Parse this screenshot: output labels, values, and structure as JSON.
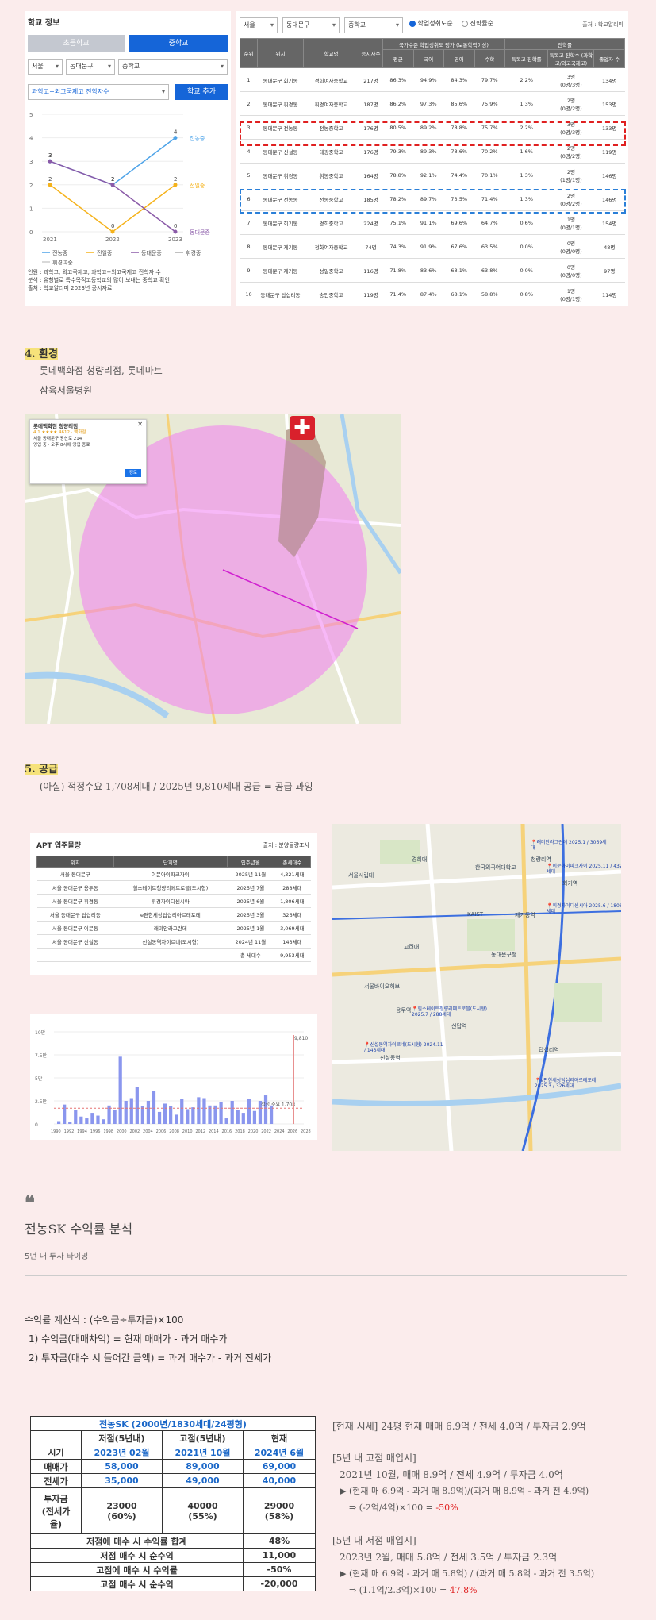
{
  "school": {
    "title": "학교 정보",
    "tab_elementary": "초등학교",
    "tab_middle": "중학교",
    "filter_city": "서울",
    "filter_district": "동대문구",
    "filter_level": "중학교",
    "filter_metric": "과학고+외고국제고 진학자수",
    "add_button": "학교 추가",
    "right_filter_city": "서울",
    "right_filter_district": "동대문구",
    "right_filter_level": "중학교",
    "radio_achievement": "학업성취도순",
    "radio_advance": "진학률순",
    "source": "출처 : 학교알리미",
    "chart_notes": [
      "인원 : 과학고, 외고국제고, 과학고+외고국제고 진학자 수",
      "분석 : 유형별로 특수목적고등학교의 많이 보내는 중학교 확인",
      "출처 : 학교알리미 2023년 공시자료"
    ],
    "table": {
      "headers_top": [
        "순위",
        "위치",
        "학교명",
        "응시자수",
        "국가수준 학업성취도 평가 (보통학력이상)",
        "진학률"
      ],
      "headers_sub": [
        "평균",
        "국어",
        "영어",
        "수학",
        "특목고 진학률",
        "특목고 진학수 (과학고/외고국제고)",
        "졸업자 수"
      ],
      "rows": [
        [
          "1",
          "동대문구 회기동",
          "경희여자중학교",
          "217명",
          "86.3%",
          "94.9%",
          "84.3%",
          "79.7%",
          "2.2%",
          "3명\n(0명/3명)",
          "134명"
        ],
        [
          "2",
          "동대문구 휘경동",
          "휘경여자중학교",
          "187명",
          "86.2%",
          "97.3%",
          "85.6%",
          "75.9%",
          "1.3%",
          "2명\n(0명/2명)",
          "153명"
        ],
        [
          "3",
          "동대문구 전농동",
          "전농중학교",
          "176명",
          "80.5%",
          "89.2%",
          "78.8%",
          "75.7%",
          "2.2%",
          "3명\n(0명/3명)",
          "133명"
        ],
        [
          "4",
          "동대문구 신설동",
          "대광중학교",
          "176명",
          "79.3%",
          "89.3%",
          "78.6%",
          "70.2%",
          "1.6%",
          "2명\n(0명/2명)",
          "119명"
        ],
        [
          "5",
          "동대문구 휘경동",
          "휘봉중학교",
          "164명",
          "78.8%",
          "92.1%",
          "74.4%",
          "70.1%",
          "1.3%",
          "2명\n(1명/1명)",
          "146명"
        ],
        [
          "6",
          "동대문구 전농동",
          "전동중학교",
          "185명",
          "78.2%",
          "89.7%",
          "73.5%",
          "71.4%",
          "1.3%",
          "2명\n(0명/2명)",
          "146명"
        ],
        [
          "7",
          "동대문구 회기동",
          "경희중학교",
          "224명",
          "75.1%",
          "91.1%",
          "69.6%",
          "64.7%",
          "0.6%",
          "1명\n(0명/1명)",
          "154명"
        ],
        [
          "8",
          "동대문구 제기동",
          "정화여자중학교",
          "74명",
          "74.3%",
          "91.9%",
          "67.6%",
          "63.5%",
          "0.0%",
          "0명\n(0명/0명)",
          "48명"
        ],
        [
          "9",
          "동대문구 제기동",
          "성일중학교",
          "116명",
          "71.8%",
          "83.6%",
          "68.1%",
          "63.8%",
          "0.0%",
          "0명\n(0명/0명)",
          "97명"
        ],
        [
          "10",
          "동대문구 답십리동",
          "숭인중학교",
          "119명",
          "71.4%",
          "87.4%",
          "68.1%",
          "58.8%",
          "0.8%",
          "1명\n(0명/1명)",
          "114명"
        ]
      ]
    }
  },
  "chart_data": [
    {
      "type": "line",
      "x": [
        "2021",
        "2022",
        "2023"
      ],
      "ylim": [
        0,
        5
      ],
      "yticks": [
        "0",
        "1",
        "2",
        "3",
        "4",
        "5"
      ],
      "series": [
        {
          "name": "전농중",
          "values": [
            3,
            2,
            4
          ],
          "color": "#4da3e8"
        },
        {
          "name": "전일중",
          "values": [
            2,
            0,
            2
          ],
          "color": "#f5b21a"
        },
        {
          "name": "동대문중",
          "values": [
            3,
            2,
            0
          ],
          "color": "#8a5aa8"
        }
      ],
      "legend": [
        "전농중",
        "전일중",
        "동대문중",
        "휘경중",
        "휘경여중"
      ],
      "end_labels": [
        "전농중",
        "전일중",
        "동대문중"
      ]
    },
    {
      "type": "bar",
      "ylim": [
        0,
        10
      ],
      "yticks": [
        "0",
        "2.5만",
        "5만",
        "7.5만",
        "10만"
      ],
      "xticks": [
        "1990",
        "1992",
        "1994",
        "1996",
        "1998",
        "2000",
        "2002",
        "2004",
        "2006",
        "2008",
        "2010",
        "2012",
        "2014",
        "2016",
        "2018",
        "2020",
        "2022",
        "2024",
        "2026",
        "2028"
      ],
      "values": [
        0.3,
        2.1,
        0.2,
        1.5,
        0.8,
        0.6,
        1.2,
        0.9,
        0.5,
        2.0,
        1.5,
        7.3,
        2.5,
        2.8,
        4.0,
        1.9,
        2.5,
        3.6,
        1.3,
        2.2,
        1.9,
        1.0,
        2.7,
        1.6,
        1.8,
        2.9,
        2.8,
        2.0,
        2.0,
        2.4,
        0.6,
        2.5,
        1.5,
        1.2,
        2.7,
        1.4,
        2.5,
        3.1,
        2.0
      ],
      "avg_label": "적정 수요 1,708",
      "marker_label": "9,810",
      "avg_value": 1.7
    }
  ],
  "env": {
    "heading": "4. 환경",
    "items": [
      "롯데백화점 청량리점, 롯데마트",
      "삼육서울병원"
    ]
  },
  "supply": {
    "heading": "5. 공급",
    "item": "(아실) 적정수요 1,708세대 / 2025년 9,810세대 공급 = 공급 과잉",
    "apt_title": "APT 입주물량",
    "apt_source": "출처 : 분양물량조사",
    "apt_headers": [
      "위치",
      "단지명",
      "입주년월",
      "총세대수"
    ],
    "apt_rows": [
      [
        "서울 동대문구",
        "이문아이파크자이",
        "2025년 11월",
        "4,321세대"
      ],
      [
        "서울 동대문구 용두동",
        "힐스테이트청량리메트로블(도시형)",
        "2025년 7월",
        "288세대"
      ],
      [
        "서울 동대문구 휘경동",
        "휘경자이디센시아",
        "2025년 6월",
        "1,806세대"
      ],
      [
        "서울 동대문구 답십리동",
        "e편한세상답십리아르테포레",
        "2025년 3월",
        "326세대"
      ],
      [
        "서울 동대문구 이문동",
        "래미안라그란데",
        "2025년 1월",
        "3,069세대"
      ],
      [
        "서울 동대문구 신설동",
        "신설동역자이르네(도시형)",
        "2024년 11월",
        "143세대"
      ],
      [
        "",
        "",
        "총 세대수",
        "9,953세대"
      ]
    ]
  },
  "map1": {
    "popup_title": "롯데백화점 청량리점",
    "popup_rating": "4.1 ★★★★ 4612 · 백화점",
    "popup_line1": "서울 동대문구 왕산로 214",
    "popup_line2": "영업 중 · 오후 8시에 영업 종료",
    "popup_button": "경로"
  },
  "map2": {
    "pins": [
      "래미안라그란데 2025.1 / 3069세대",
      "이문아이파크자이 2025.11 / 4321세대",
      "휘경자이디센시아 2025.6 / 1806세대",
      "힐스테이트청량리메트로블(도시형) 2025.7 / 288세대",
      "신설동역자이르네(도시형) 2024.11 / 143세대",
      "e편한세상답십리아르테포레 2025.3 / 326세대"
    ],
    "labels": [
      "서울시립대",
      "경희대",
      "한국외국어대학교",
      "KAIST",
      "청량리역",
      "회기역",
      "신설동역",
      "답십리역",
      "동대문구청",
      "고려대",
      "신답역",
      "용두역",
      "제기동역",
      "서울바이오허브"
    ]
  },
  "analysis": {
    "quote": "❝",
    "title": "전농SK 수익률 분석",
    "subtitle": "5년 내 투자 타이밍",
    "formula": "수익률 계산식 : (수익금÷투자금)×100",
    "line1": "1) 수익금(매매차익) = 현재 매매가 - 과거 매수가",
    "line2": "2) 투자금(매수 시 들어간 금액) = 과거 매수가 - 과거 전세가",
    "roi_title": "전농SK (2000년/1830세대/24평형)",
    "roi_cols": [
      "저점(5년내)",
      "고점(5년내)",
      "현재"
    ],
    "roi_period_label": "시기",
    "roi_period": [
      "2023년 02월",
      "2021년 10월",
      "2024년 6월"
    ],
    "roi_price_label": "매매가",
    "roi_price": [
      "58,000",
      "89,000",
      "69,000"
    ],
    "roi_jeonse_label": "전세가",
    "roi_jeonse": [
      "35,000",
      "49,000",
      "40,000"
    ],
    "roi_invest_label": "투자금\n(전세가\n율)",
    "roi_invest": [
      "23000\n(60%)",
      "40000\n(55%)",
      "29000\n(58%)"
    ],
    "roi_summary": [
      [
        "저점에 매수 시 수익률 합계",
        "48%"
      ],
      [
        "저점 매수 시 순수익",
        "11,000"
      ],
      [
        "고점에 매수 시 수익률",
        "-50%"
      ],
      [
        "고점 매수 시 순수익",
        "-20,000"
      ]
    ],
    "note_now": "[현재 시세] 24평 현재 매매 6.9억 / 전세 4.0억 / 투자금 2.9억",
    "note_high_title": "[5년 내 고점 매입시]",
    "note_high_1": "2021년 10월, 매매 8.9억 / 전세 4.9억 / 투자금 4.0억",
    "note_high_2": "▶ (현재 매 6.9억 - 과거 매 8.9억)/(과거 매 8.9억 - 과거 전 4.9억)",
    "note_high_3a": "⇒ (-2억/4억)×100 = ",
    "note_high_3b": "-50%",
    "note_low_title": "[5년 내 저점 매입시]",
    "note_low_1": "2023년 2월, 매매 5.8억 / 전세 3.5억 / 투자금 2.3억",
    "note_low_2": "▶ (현재 매 6.9억 - 과거 매 5.8억) / (과거 매 5.8억 - 과거 전 3.5억)",
    "note_low_3a": "⇒ (1.1억/2.3억)×100 = ",
    "note_low_3b": "47.8%"
  }
}
